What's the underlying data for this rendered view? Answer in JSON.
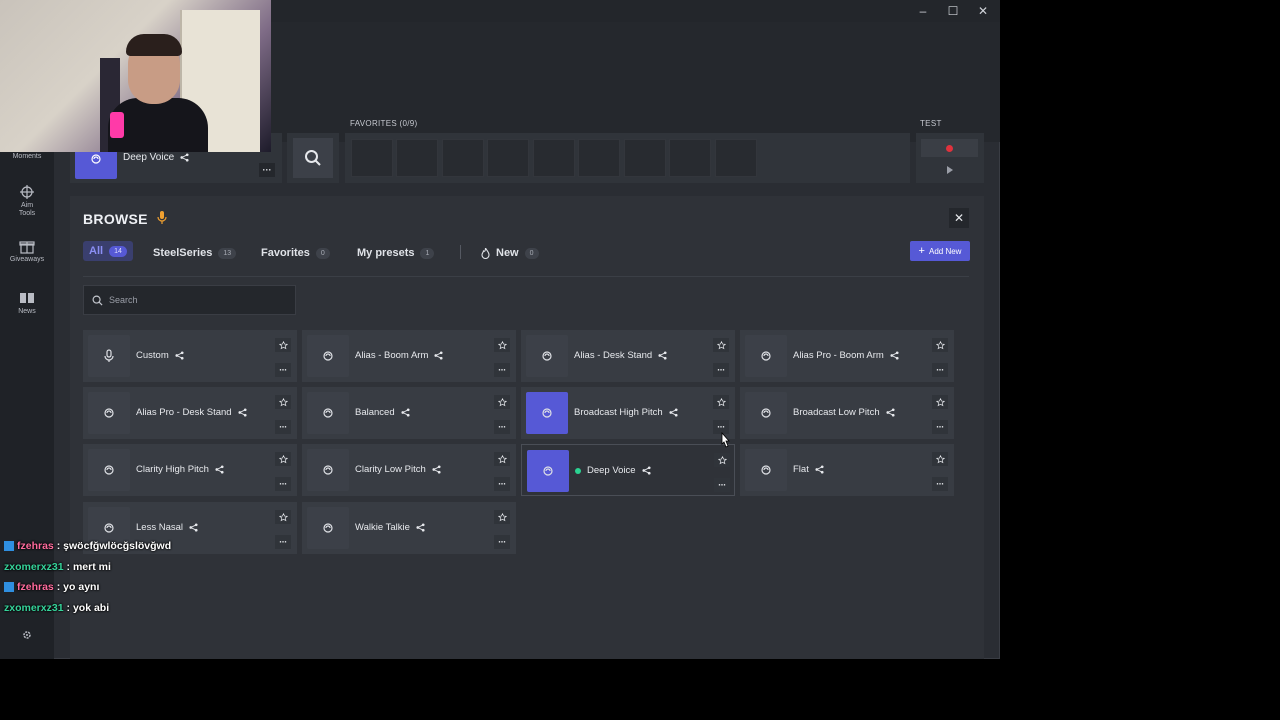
{
  "window": {
    "controls": {
      "minimize": "–",
      "maximize": "☐",
      "close": "✕"
    }
  },
  "sidebar": {
    "items": [
      {
        "label": "Moments",
        "icon": "moments-icon"
      },
      {
        "label": "Aim\nTools",
        "icon": "crosshair-icon"
      },
      {
        "label": "Giveaways",
        "icon": "gift-icon"
      },
      {
        "label": "News",
        "icon": "news-icon"
      }
    ],
    "settings_icon": "gear-icon"
  },
  "top": {
    "current_preset": "Deep Voice",
    "favorites_label": "FAVORITES (0/9)",
    "test_label": "TEST",
    "favorite_slots": 9
  },
  "browse": {
    "title": "BROWSE",
    "tabs": [
      {
        "label": "All",
        "count": "14",
        "active": true
      },
      {
        "label": "SteelSeries",
        "count": "13"
      },
      {
        "label": "Favorites",
        "count": "0"
      },
      {
        "label": "My presets",
        "count": "1"
      },
      {
        "label": "New",
        "count": "0"
      }
    ],
    "add_new": "Add New",
    "search_placeholder": "Search",
    "presets": [
      {
        "name": "Custom",
        "icon": "mic-icon"
      },
      {
        "name": "Alias - Boom Arm"
      },
      {
        "name": "Alias - Desk Stand"
      },
      {
        "name": "Alias Pro - Boom Arm"
      },
      {
        "name": "Alias Pro - Desk Stand"
      },
      {
        "name": "Balanced"
      },
      {
        "name": "Broadcast High Pitch",
        "active_thumb": true
      },
      {
        "name": "Broadcast Low Pitch"
      },
      {
        "name": "Clarity High Pitch"
      },
      {
        "name": "Clarity Low Pitch"
      },
      {
        "name": "Deep Voice",
        "active_thumb": true,
        "selected": true,
        "status": "active"
      },
      {
        "name": "Flat"
      },
      {
        "name": "Less Nasal"
      },
      {
        "name": "Walkie Talkie"
      }
    ]
  },
  "chat": [
    {
      "user": "fzehras",
      "color": "#ff6b9d",
      "message": ": şwöcfğwlöcğslövğwd",
      "badge": true
    },
    {
      "user": "zxomerxz31",
      "color": "#35d39a",
      "message": ": mert mi",
      "badge": false
    },
    {
      "user": "fzehras",
      "color": "#ff6b9d",
      "message": ": yo aynı",
      "badge": true
    },
    {
      "user": "zxomerxz31",
      "color": "#35d39a",
      "message": ": yok abi",
      "badge": false
    }
  ],
  "colors": {
    "accent": "#5659d6",
    "active_dot": "#2bd392",
    "record": "#e0323d"
  }
}
